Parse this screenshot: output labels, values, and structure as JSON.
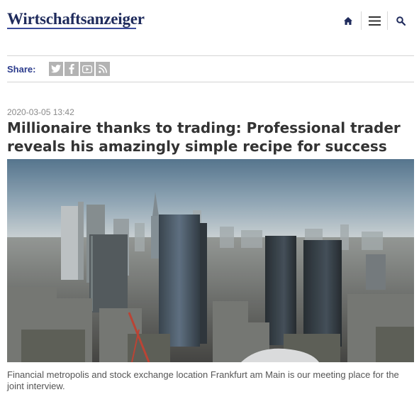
{
  "site": {
    "name": "Wirtschaftsanzeiger"
  },
  "nav": {
    "home_icon": "home-icon",
    "menu_icon": "menu-icon",
    "search_icon": "search-icon"
  },
  "share": {
    "label": "Share:",
    "networks": [
      "twitter-icon",
      "facebook-icon",
      "youtube-icon",
      "rss-icon"
    ]
  },
  "article": {
    "timestamp": "2020-03-05 13:42",
    "title": "Millionaire thanks to trading: Professional trader reveals his amazingly simple recipe for success",
    "image_caption": "Financial metropolis and stock exchange location Frankfurt am Main is our meeting place for the joint interview."
  },
  "colors": {
    "brand": "#1f2b5c",
    "share_label": "#2b3b8c",
    "social_bg": "#b3b3b3"
  }
}
